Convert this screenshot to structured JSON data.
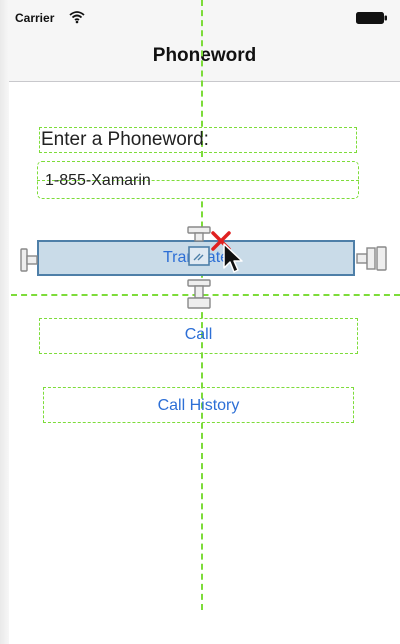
{
  "status_bar": {
    "carrier": "Carrier",
    "icons": [
      "wifi-icon",
      "battery-icon"
    ]
  },
  "nav_bar": {
    "title": "Phoneword"
  },
  "form": {
    "label": "Enter a Phoneword:",
    "input_value": "1-855-Xamarin",
    "translate_button": "Translate",
    "call_button": "Call",
    "call_history_button": "Call History"
  },
  "designer": {
    "guide_color": "#7ddc3a",
    "selection_color": "#4e7fa8",
    "delete_color": "#e02020",
    "icons": [
      "resize-handle-icon",
      "cursor-icon",
      "delete-icon"
    ]
  },
  "colors": {
    "link_blue": "#2d6fd6",
    "selected_fill": "#c9dbe8"
  }
}
